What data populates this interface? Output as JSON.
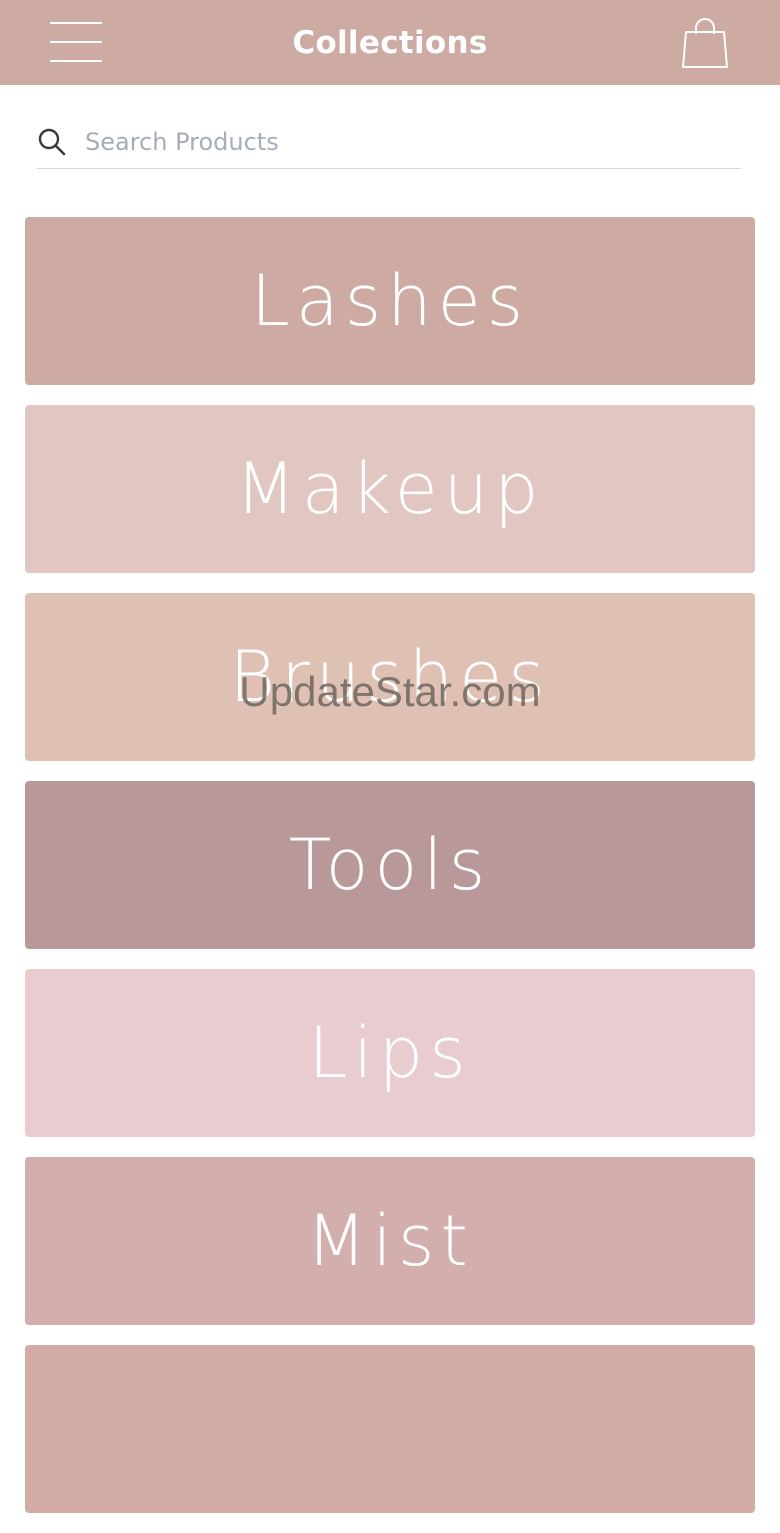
{
  "colors": {
    "header": "#cdaba3",
    "tiles": [
      "#cdaba2",
      "#e1c6c1",
      "#dfc1b4",
      "#b89898",
      "#e8cccf",
      "#d2aeac",
      "#d3ada5"
    ]
  },
  "header": {
    "title": "Collections",
    "menu_icon": "hamburger-menu-icon",
    "cart_icon": "shopping-bag-icon"
  },
  "search": {
    "placeholder": "Search Products",
    "value": "",
    "icon": "search-icon"
  },
  "collections": [
    {
      "label": "Lashes"
    },
    {
      "label": "Makeup"
    },
    {
      "label": "Brushes"
    },
    {
      "label": "Tools"
    },
    {
      "label": "Lips"
    },
    {
      "label": "Mist"
    },
    {
      "label": ""
    }
  ],
  "watermark": "UpdateStar.com"
}
